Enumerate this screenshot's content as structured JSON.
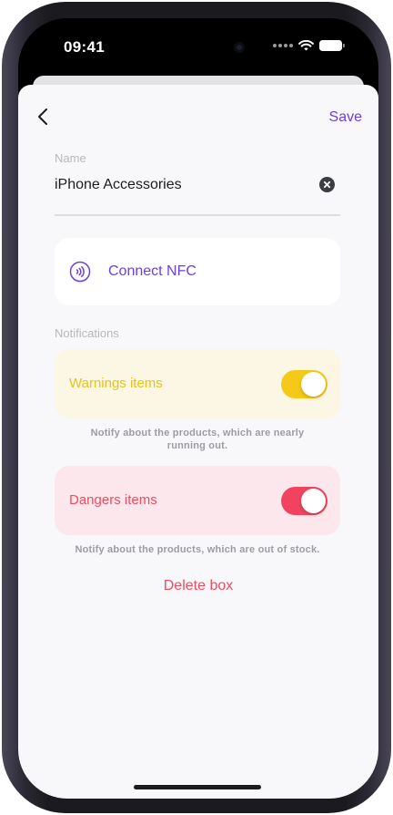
{
  "status_bar": {
    "time": "09:41",
    "icons": [
      "camera-icon",
      "cellular-dots-icon",
      "wifi-icon",
      "battery-icon"
    ]
  },
  "nav": {
    "back_icon": "chevron-left-icon",
    "save_label": "Save"
  },
  "name_field": {
    "label": "Name",
    "value": "iPhone Accessories",
    "clear_icon": "clear-circle-icon"
  },
  "nfc": {
    "icon": "nfc-icon",
    "label": "Connect NFC"
  },
  "notifications": {
    "section_label": "Notifications",
    "warnings": {
      "label": "Warnings items",
      "enabled": true,
      "hint": "Notify about the products, which are nearly running out."
    },
    "dangers": {
      "label": "Dangers items",
      "enabled": true,
      "hint": "Notify about the products, which are out of stock."
    }
  },
  "delete_label": "Delete box",
  "colors": {
    "accent": "#6b3fe0",
    "warning": "#f5c919",
    "danger": "#ef4360",
    "background": "#f8f8fb"
  }
}
